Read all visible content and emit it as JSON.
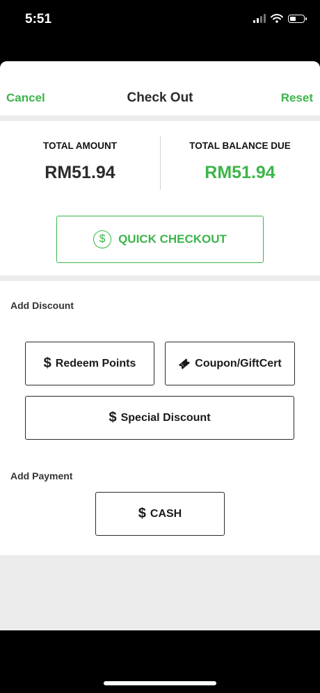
{
  "status_bar": {
    "time": "5:51"
  },
  "nav": {
    "cancel": "Cancel",
    "title": "Check Out",
    "reset": "Reset"
  },
  "totals": {
    "amount_label": "TOTAL AMOUNT",
    "amount_value": "RM51.94",
    "balance_label": "TOTAL BALANCE DUE",
    "balance_value": "RM51.94"
  },
  "quick_checkout": {
    "label": "QUICK CHECKOUT",
    "icon": "dollar-circle-icon"
  },
  "discount": {
    "section_label": "Add Discount",
    "redeem_points": "Redeem Points",
    "coupon": "Coupon/GiftCert",
    "special": "Special Discount"
  },
  "payment": {
    "section_label": "Add Payment",
    "cash": "CASH"
  },
  "colors": {
    "accent": "#3cb54a",
    "background": "#ececec",
    "text": "#222222"
  }
}
